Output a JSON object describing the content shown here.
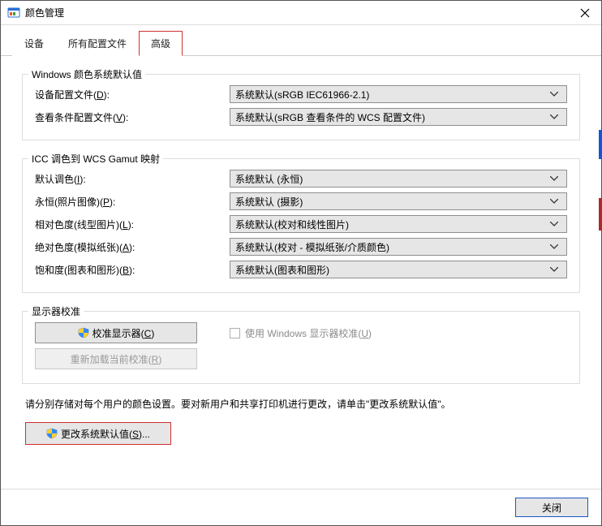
{
  "window": {
    "title": "颜色管理"
  },
  "tabs": {
    "device": "设备",
    "all_profiles": "所有配置文件",
    "advanced": "高级"
  },
  "groups": {
    "defaults": {
      "legend": "Windows 颜色系统默认值",
      "device_profile": {
        "label": "设备配置文件(",
        "hotkey": "D",
        "label_suffix": "):",
        "value": "系统默认(sRGB IEC61966-2.1)"
      },
      "viewing_profile": {
        "label": "查看条件配置文件(",
        "hotkey": "V",
        "label_suffix": "):",
        "value": "系统默认(sRGB 查看条件的 WCS 配置文件)"
      }
    },
    "gamut": {
      "legend": "ICC 调色到 WCS Gamut 映射",
      "default_render": {
        "label": "默认调色(",
        "hotkey": "I",
        "label_suffix": "):",
        "value": "系统默认 (永恒)"
      },
      "perceptual": {
        "label": "永恒(照片图像)(",
        "hotkey": "P",
        "label_suffix": "):",
        "value": "系统默认 (摄影)"
      },
      "rel_color": {
        "label": "相对色度(线型图片)(",
        "hotkey": "L",
        "label_suffix": "):",
        "value": "系统默认(校对和线性图片)"
      },
      "abs_color": {
        "label": "绝对色度(模拟纸张)(",
        "hotkey": "A",
        "label_suffix": "):",
        "value": "系统默认(校对 - 模拟纸张/介质颜色)"
      },
      "saturation": {
        "label": "饱和度(图表和图形)(",
        "hotkey": "B",
        "label_suffix": "):",
        "value": "系统默认(图表和图形)"
      }
    },
    "calibration": {
      "legend": "显示器校准",
      "calibrate_btn": {
        "label": "校准显示器(",
        "hotkey": "C",
        "suffix": ")"
      },
      "use_windows": {
        "label": "使用 Windows 显示器校准(",
        "hotkey": "U",
        "suffix": ")"
      },
      "reload_btn": {
        "label": "重新加载当前校准(",
        "hotkey": "R",
        "suffix": ")"
      }
    }
  },
  "note": "请分别存储对每个用户的颜色设置。要对新用户和共享打印机进行更改，请单击\"更改系统默认值\"。",
  "change_defaults_btn": {
    "label": "更改系统默认值(",
    "hotkey": "S",
    "suffix": ")..."
  },
  "close_btn": "关闭"
}
